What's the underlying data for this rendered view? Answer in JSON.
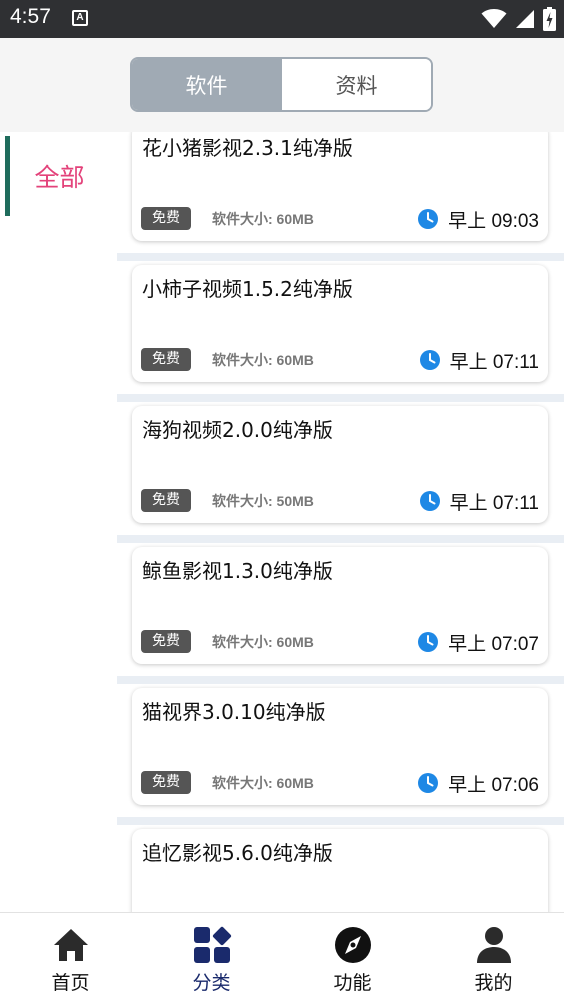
{
  "status_bar": {
    "time": "4:57",
    "app_icon_letter": "A",
    "icons": [
      "wifi-icon",
      "signal-icon",
      "battery-icon"
    ]
  },
  "segment": {
    "tabs": [
      {
        "label": "软件",
        "active": true
      },
      {
        "label": "资料",
        "active": false
      }
    ]
  },
  "sidebar": {
    "items": [
      {
        "label": "全部",
        "active": true
      }
    ]
  },
  "list": {
    "items": [
      {
        "title": "花小猪影视2.3.1纯净版",
        "badge": "免费",
        "size": "软件大小: 60MB",
        "time": "早上 09:03"
      },
      {
        "title": "小柿子视频1.5.2纯净版",
        "badge": "免费",
        "size": "软件大小: 60MB",
        "time": "早上 07:11"
      },
      {
        "title": "海狗视频2.0.0纯净版",
        "badge": "免费",
        "size": "软件大小: 50MB",
        "time": "早上 07:11"
      },
      {
        "title": "鲸鱼影视1.3.0纯净版",
        "badge": "免费",
        "size": "软件大小: 60MB",
        "time": "早上 07:07"
      },
      {
        "title": "猫视界3.0.10纯净版",
        "badge": "免费",
        "size": "软件大小: 60MB",
        "time": "早上 07:06"
      },
      {
        "title": "追忆影视5.6.0纯净版"
      }
    ]
  },
  "bottom_nav": {
    "items": [
      {
        "label": "首页",
        "icon": "home-icon",
        "active": false
      },
      {
        "label": "分类",
        "icon": "category-icon",
        "active": true
      },
      {
        "label": "功能",
        "icon": "compass-icon",
        "active": false
      },
      {
        "label": "我的",
        "icon": "person-icon",
        "active": false
      }
    ]
  },
  "colors": {
    "status_bar": "#2f3033",
    "segment_active": "#a0aab4",
    "sidebar_accent": "#1f6c5c",
    "sidebar_text": "#e3427a",
    "clock_icon": "#1e88e5",
    "nav_active": "#1a2a6c"
  }
}
